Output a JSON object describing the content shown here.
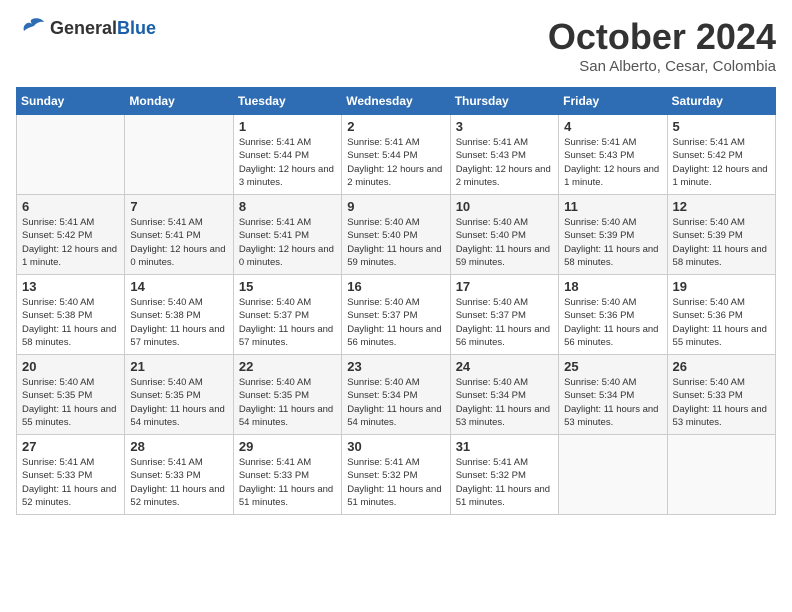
{
  "logo": {
    "general": "General",
    "blue": "Blue"
  },
  "title": "October 2024",
  "location": "San Alberto, Cesar, Colombia",
  "weekdays": [
    "Sunday",
    "Monday",
    "Tuesday",
    "Wednesday",
    "Thursday",
    "Friday",
    "Saturday"
  ],
  "weeks": [
    [
      {
        "day": "",
        "info": ""
      },
      {
        "day": "",
        "info": ""
      },
      {
        "day": "1",
        "info": "Sunrise: 5:41 AM\nSunset: 5:44 PM\nDaylight: 12 hours and 3 minutes."
      },
      {
        "day": "2",
        "info": "Sunrise: 5:41 AM\nSunset: 5:44 PM\nDaylight: 12 hours and 2 minutes."
      },
      {
        "day": "3",
        "info": "Sunrise: 5:41 AM\nSunset: 5:43 PM\nDaylight: 12 hours and 2 minutes."
      },
      {
        "day": "4",
        "info": "Sunrise: 5:41 AM\nSunset: 5:43 PM\nDaylight: 12 hours and 1 minute."
      },
      {
        "day": "5",
        "info": "Sunrise: 5:41 AM\nSunset: 5:42 PM\nDaylight: 12 hours and 1 minute."
      }
    ],
    [
      {
        "day": "6",
        "info": "Sunrise: 5:41 AM\nSunset: 5:42 PM\nDaylight: 12 hours and 1 minute."
      },
      {
        "day": "7",
        "info": "Sunrise: 5:41 AM\nSunset: 5:41 PM\nDaylight: 12 hours and 0 minutes."
      },
      {
        "day": "8",
        "info": "Sunrise: 5:41 AM\nSunset: 5:41 PM\nDaylight: 12 hours and 0 minutes."
      },
      {
        "day": "9",
        "info": "Sunrise: 5:40 AM\nSunset: 5:40 PM\nDaylight: 11 hours and 59 minutes."
      },
      {
        "day": "10",
        "info": "Sunrise: 5:40 AM\nSunset: 5:40 PM\nDaylight: 11 hours and 59 minutes."
      },
      {
        "day": "11",
        "info": "Sunrise: 5:40 AM\nSunset: 5:39 PM\nDaylight: 11 hours and 58 minutes."
      },
      {
        "day": "12",
        "info": "Sunrise: 5:40 AM\nSunset: 5:39 PM\nDaylight: 11 hours and 58 minutes."
      }
    ],
    [
      {
        "day": "13",
        "info": "Sunrise: 5:40 AM\nSunset: 5:38 PM\nDaylight: 11 hours and 58 minutes."
      },
      {
        "day": "14",
        "info": "Sunrise: 5:40 AM\nSunset: 5:38 PM\nDaylight: 11 hours and 57 minutes."
      },
      {
        "day": "15",
        "info": "Sunrise: 5:40 AM\nSunset: 5:37 PM\nDaylight: 11 hours and 57 minutes."
      },
      {
        "day": "16",
        "info": "Sunrise: 5:40 AM\nSunset: 5:37 PM\nDaylight: 11 hours and 56 minutes."
      },
      {
        "day": "17",
        "info": "Sunrise: 5:40 AM\nSunset: 5:37 PM\nDaylight: 11 hours and 56 minutes."
      },
      {
        "day": "18",
        "info": "Sunrise: 5:40 AM\nSunset: 5:36 PM\nDaylight: 11 hours and 56 minutes."
      },
      {
        "day": "19",
        "info": "Sunrise: 5:40 AM\nSunset: 5:36 PM\nDaylight: 11 hours and 55 minutes."
      }
    ],
    [
      {
        "day": "20",
        "info": "Sunrise: 5:40 AM\nSunset: 5:35 PM\nDaylight: 11 hours and 55 minutes."
      },
      {
        "day": "21",
        "info": "Sunrise: 5:40 AM\nSunset: 5:35 PM\nDaylight: 11 hours and 54 minutes."
      },
      {
        "day": "22",
        "info": "Sunrise: 5:40 AM\nSunset: 5:35 PM\nDaylight: 11 hours and 54 minutes."
      },
      {
        "day": "23",
        "info": "Sunrise: 5:40 AM\nSunset: 5:34 PM\nDaylight: 11 hours and 54 minutes."
      },
      {
        "day": "24",
        "info": "Sunrise: 5:40 AM\nSunset: 5:34 PM\nDaylight: 11 hours and 53 minutes."
      },
      {
        "day": "25",
        "info": "Sunrise: 5:40 AM\nSunset: 5:34 PM\nDaylight: 11 hours and 53 minutes."
      },
      {
        "day": "26",
        "info": "Sunrise: 5:40 AM\nSunset: 5:33 PM\nDaylight: 11 hours and 53 minutes."
      }
    ],
    [
      {
        "day": "27",
        "info": "Sunrise: 5:41 AM\nSunset: 5:33 PM\nDaylight: 11 hours and 52 minutes."
      },
      {
        "day": "28",
        "info": "Sunrise: 5:41 AM\nSunset: 5:33 PM\nDaylight: 11 hours and 52 minutes."
      },
      {
        "day": "29",
        "info": "Sunrise: 5:41 AM\nSunset: 5:33 PM\nDaylight: 11 hours and 51 minutes."
      },
      {
        "day": "30",
        "info": "Sunrise: 5:41 AM\nSunset: 5:32 PM\nDaylight: 11 hours and 51 minutes."
      },
      {
        "day": "31",
        "info": "Sunrise: 5:41 AM\nSunset: 5:32 PM\nDaylight: 11 hours and 51 minutes."
      },
      {
        "day": "",
        "info": ""
      },
      {
        "day": "",
        "info": ""
      }
    ]
  ]
}
